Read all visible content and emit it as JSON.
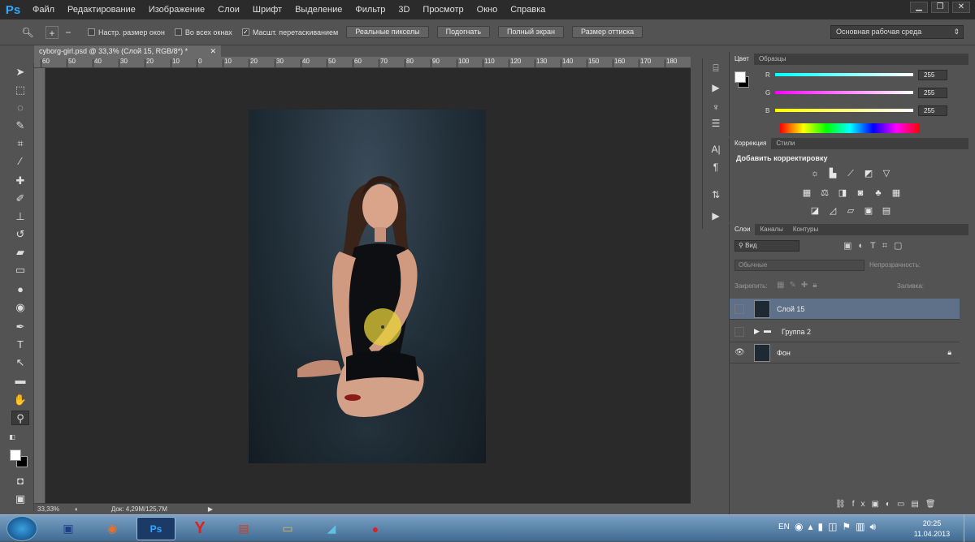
{
  "app": {
    "logo": "Ps"
  },
  "menu": [
    "Файл",
    "Редактирование",
    "Изображение",
    "Слои",
    "Шрифт",
    "Выделение",
    "Фильтр",
    "3D",
    "Просмотр",
    "Окно",
    "Справка"
  ],
  "window_controls": {
    "minimize": "▁",
    "restore": "❐",
    "close": "✕"
  },
  "options_bar": {
    "resize_windows": "Настр. размер окон",
    "all_windows": "Во всех окнах",
    "scrubby_zoom": "Масшт. перетаскиванием",
    "actual_pixels": "Реальные пикселы",
    "fit_screen": "Подогнать",
    "fill_screen": "Полный экран",
    "print_size": "Размер оттиска",
    "workspace": "Основная рабочая среда"
  },
  "document": {
    "tab_title": "cyborg-girl.psd @ 33,3% (Слой 15, RGB/8*) *",
    "zoom": "33,33%",
    "doc_size": "Док: 4,29M/125,7M"
  },
  "ruler_labels": [
    "60",
    "50",
    "40",
    "30",
    "20",
    "10",
    "0",
    "10",
    "20",
    "30",
    "40",
    "50",
    "60",
    "70",
    "80",
    "90",
    "100",
    "110",
    "120",
    "130",
    "140",
    "150",
    "160",
    "170",
    "180"
  ],
  "color_panel": {
    "tabs": [
      "Цвет",
      "Образцы"
    ],
    "channels": [
      {
        "label": "R",
        "value": "255",
        "color": "#22c3dd"
      },
      {
        "label": "G",
        "value": "255",
        "color": "#dd3cc8"
      },
      {
        "label": "B",
        "value": "255",
        "color": "#e6e022"
      }
    ]
  },
  "adjustments_panel": {
    "tabs": [
      "Коррекция",
      "Стили"
    ],
    "heading": "Добавить корректировку"
  },
  "layers_panel": {
    "tabs": [
      "Слои",
      "Каналы",
      "Контуры"
    ],
    "filter": "Вид",
    "blend_mode": "Обычные",
    "opacity_label": "Непрозрачность:",
    "lock_label": "Закрепить:",
    "fill_label": "Заливка:",
    "layers": [
      {
        "name": "Слой 15",
        "selected": true,
        "visible": false
      },
      {
        "name": "Группа 2",
        "selected": false,
        "visible": false
      },
      {
        "name": "Фон",
        "selected": false,
        "visible": true
      }
    ]
  },
  "taskbar": {
    "lang": "EN",
    "time": "20:25",
    "date": "11.04.2013"
  }
}
